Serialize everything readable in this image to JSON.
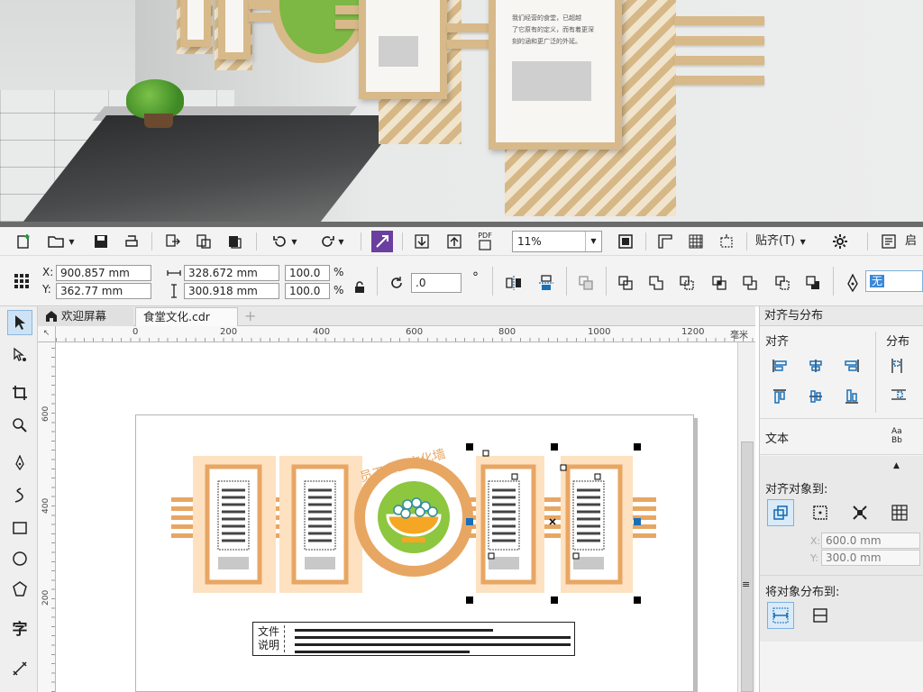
{
  "render_preview": {
    "frame_text_lines": [
      "我们经营的食堂，已超越",
      "了它原有的定义，而有着更深",
      "刻的涵和更广泛的外延。"
    ]
  },
  "toolbar_standard": {
    "zoom_value": "11%",
    "snap_label": "贴齐(T)",
    "start_label": "启",
    "pdf_label": "PDF"
  },
  "property_bar": {
    "x_label": "X:",
    "x_value": "900.857 mm",
    "y_label": "Y:",
    "y_value": "362.77 mm",
    "width_value": "328.672 mm",
    "height_value": "300.918 mm",
    "scale_w": "100.0",
    "scale_h": "100.0",
    "percent": "%",
    "rotation": ".0",
    "degree": "°",
    "outline_value": "无"
  },
  "tabs": [
    {
      "label": "欢迎屏幕"
    },
    {
      "label": "食堂文化.cdr"
    }
  ],
  "ruler": {
    "unit": "毫米",
    "h_ticks": [
      "0",
      "200",
      "400",
      "600",
      "800",
      "1000",
      "1200"
    ],
    "v_ticks": [
      "600",
      "400",
      "200"
    ],
    "corner": "↖"
  },
  "artwork": {
    "title": "员工食堂文化墙",
    "note_line1": "文件",
    "note_line2": "说明"
  },
  "docker": {
    "title": "对齐与分布",
    "align_label": "对齐",
    "distribute_label": "分布",
    "text_label": "文本",
    "text_icon": "Aa Bb",
    "align_to_label": "对齐对象到:",
    "x_label": "X:",
    "x_value": "600.0 mm",
    "y_label": "Y:",
    "y_value": "300.0 mm",
    "distribute_to_label": "将对象分布到:"
  },
  "tools": [
    "pick-tool",
    "shape-tool",
    "crop-tool",
    "zoom-tool",
    "freehand-tool",
    "artistic-media-tool",
    "rectangle-tool",
    "ellipse-tool",
    "polygon-tool",
    "text-tool",
    "parallel-dimension-tool"
  ],
  "text_tool_glyph": "字",
  "colors": {
    "accent": "#1b6fb8",
    "wood": "#d7b98a",
    "orange": "#e8a663",
    "green": "#8dc63f",
    "bowl": "#f5a623"
  }
}
